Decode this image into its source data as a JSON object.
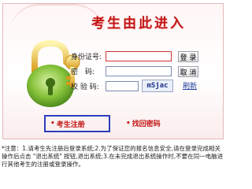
{
  "header": {
    "title": "考生由此进入"
  },
  "form": {
    "id_label": "身份证号:",
    "password_label": "密　码:",
    "captcha_label": "校 验 码:",
    "captcha_code": "mSjac",
    "login_label": "登 录",
    "cancel_label": "取 消",
    "refresh_label": "刷新"
  },
  "links": {
    "register_bullet": "•",
    "register_label": "考生注册",
    "findpwd_bullet": "•",
    "findpwd_label": "找回密码"
  },
  "notice": {
    "text": "*注意：1.请考生先注册后登录系统;2.为了保证您的报名信息安全,请在登录完成相关操作后点击 \"退出系统\" 按钮,退出系统;3.在未完成退出系统操作时,不要在同一电脑进行其他考生的注册或登录操作。"
  },
  "colors": {
    "title": "#c21414",
    "link": "#c21414",
    "accent": "#2b3fbd",
    "lock_green": "#7bb52b",
    "lock_gold": "#e8b62b"
  },
  "icons": {
    "lock": "padlock-icon"
  }
}
